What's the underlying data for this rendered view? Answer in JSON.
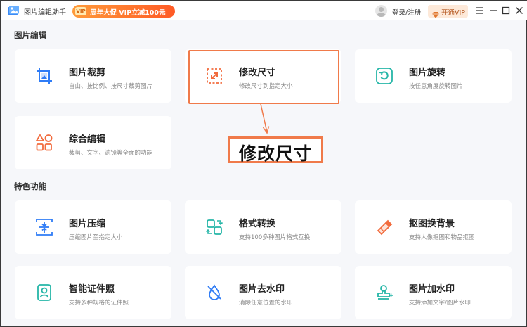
{
  "app": {
    "title": "图片编辑助手"
  },
  "header": {
    "promo_badge": "VIP",
    "promo_text": "周年大促 VIP立减100元",
    "login_label": "登录/注册",
    "vip_button_label": "开通VIP"
  },
  "sections": {
    "edit_title": "图片编辑",
    "feature_title": "特色功能"
  },
  "cards": {
    "crop": {
      "title": "图片裁剪",
      "desc": "自由、按比例、按尺寸裁剪图片"
    },
    "resize": {
      "title": "修改尺寸",
      "desc": "修改尺寸到指定大小"
    },
    "rotate": {
      "title": "图片旋转",
      "desc": "按任意角度旋转图片"
    },
    "combo": {
      "title": "综合编辑",
      "desc": "裁剪、文字、滤镜等全面的功能"
    },
    "compress": {
      "title": "图片压缩",
      "desc": "压缩图片至指定大小"
    },
    "convert": {
      "title": "格式转换",
      "desc": "支持100多种图片格式互换"
    },
    "cutout": {
      "title": "抠图换背景",
      "desc": "支持人像抠图和物品抠图"
    },
    "idphoto": {
      "title": "智能证件照",
      "desc": "支持多种规格的证件照"
    },
    "dewatermark": {
      "title": "图片去水印",
      "desc": "消除任意位置的水印"
    },
    "addwatermark": {
      "title": "图片加水印",
      "desc": "支持添加文字/图片水印"
    }
  },
  "callout": {
    "text": "修改尺寸"
  },
  "colors": {
    "accent_orange": "#f07a4a",
    "blue_icon": "#2f7cf6",
    "teal_icon": "#26b6a8",
    "orange_icon": "#f26c3e"
  }
}
